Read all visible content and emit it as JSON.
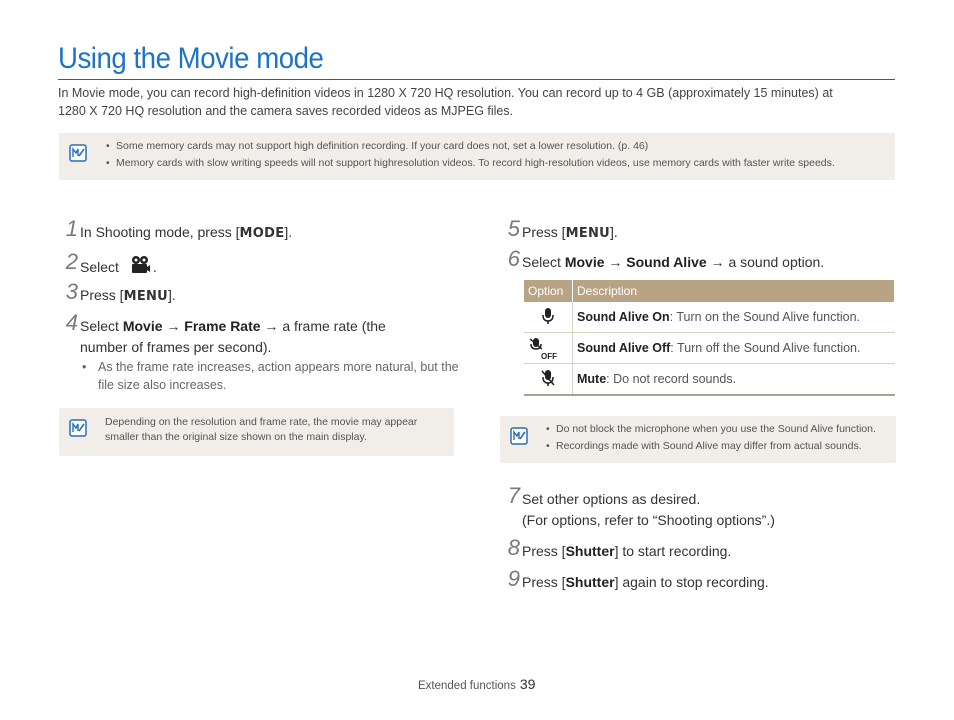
{
  "title": "Using the Movie mode",
  "intro": "In Movie mode, you can record high-definition videos in 1280 X 720 HQ resolution. You can record up to 4 GB (approximately 15 minutes) at 1280 X 720 HQ resolution and the camera saves recorded videos as MJPEG files.",
  "note1": [
    "Some memory cards may not support high definition recording. If your card does not, set a lower resolution. (p. 46)",
    "Memory cards with slow writing speeds will not support highresolution videos. To record high-resolution videos, use memory cards with faster write speeds."
  ],
  "steps": {
    "s1": {
      "num": "1",
      "pre": "In Shooting mode, press [",
      "key": "MODE",
      "post": "]."
    },
    "s2": {
      "num": "2",
      "pre": "Select",
      "post": "."
    },
    "s3": {
      "num": "3",
      "pre": "Press [",
      "key": "MENU",
      "post": "]."
    },
    "s4": {
      "num": "4",
      "pre": "Select ",
      "b1": "Movie",
      "arrow1": " → ",
      "b2": "Frame Rate",
      "post": " → a frame rate (the",
      "line2": "number of frames per second)."
    },
    "s4_sub": "As the frame rate increases, action appears more natural, but the file size also increases.",
    "s5": {
      "num": "5",
      "pre": "Press [",
      "key": "MENU",
      "post": "]."
    },
    "s6": {
      "num": "6",
      "pre": "Select ",
      "b1": "Movie",
      "arrow1": " → ",
      "b2": "Sound Alive",
      "post": " → a sound option."
    },
    "s7": {
      "num": "7",
      "line1": "Set other options as desired.",
      "line2": "(For options, refer to “Shooting options”.)"
    },
    "s8": {
      "num": "8",
      "pre": "Press [",
      "b1": "Shutter",
      "post": "] to start recording."
    },
    "s9": {
      "num": "9",
      "pre": "Press [",
      "b1": "Shutter",
      "post": "] again to stop recording."
    }
  },
  "note2": "Depending on the resolution and frame rate, the movie may appear smaller than the original size shown on the main display.",
  "table": {
    "headers": [
      "Option",
      "Description"
    ],
    "rows": [
      {
        "icon": "microphone-icon",
        "bold": "Sound Alive On",
        "desc": ": Turn on the Sound Alive function."
      },
      {
        "icon": "microphone-off-icon",
        "icon_label": "OFF",
        "bold": "Sound Alive Off",
        "desc": ": Turn off the Sound Alive function."
      },
      {
        "icon": "microphone-mute-icon",
        "bold": "Mute",
        "desc": ": Do not record sounds."
      }
    ]
  },
  "note3": [
    "Do not block the microphone when you use the Sound Alive function.",
    "Recordings made with Sound Alive may differ from actual sounds."
  ],
  "footer": {
    "section": "Extended functions",
    "page": "39"
  },
  "colors": {
    "title": "#1f73c6",
    "note_bg": "#f1ede8",
    "table_header": "#b8a385",
    "icon_blue": "#2a6fb8"
  }
}
